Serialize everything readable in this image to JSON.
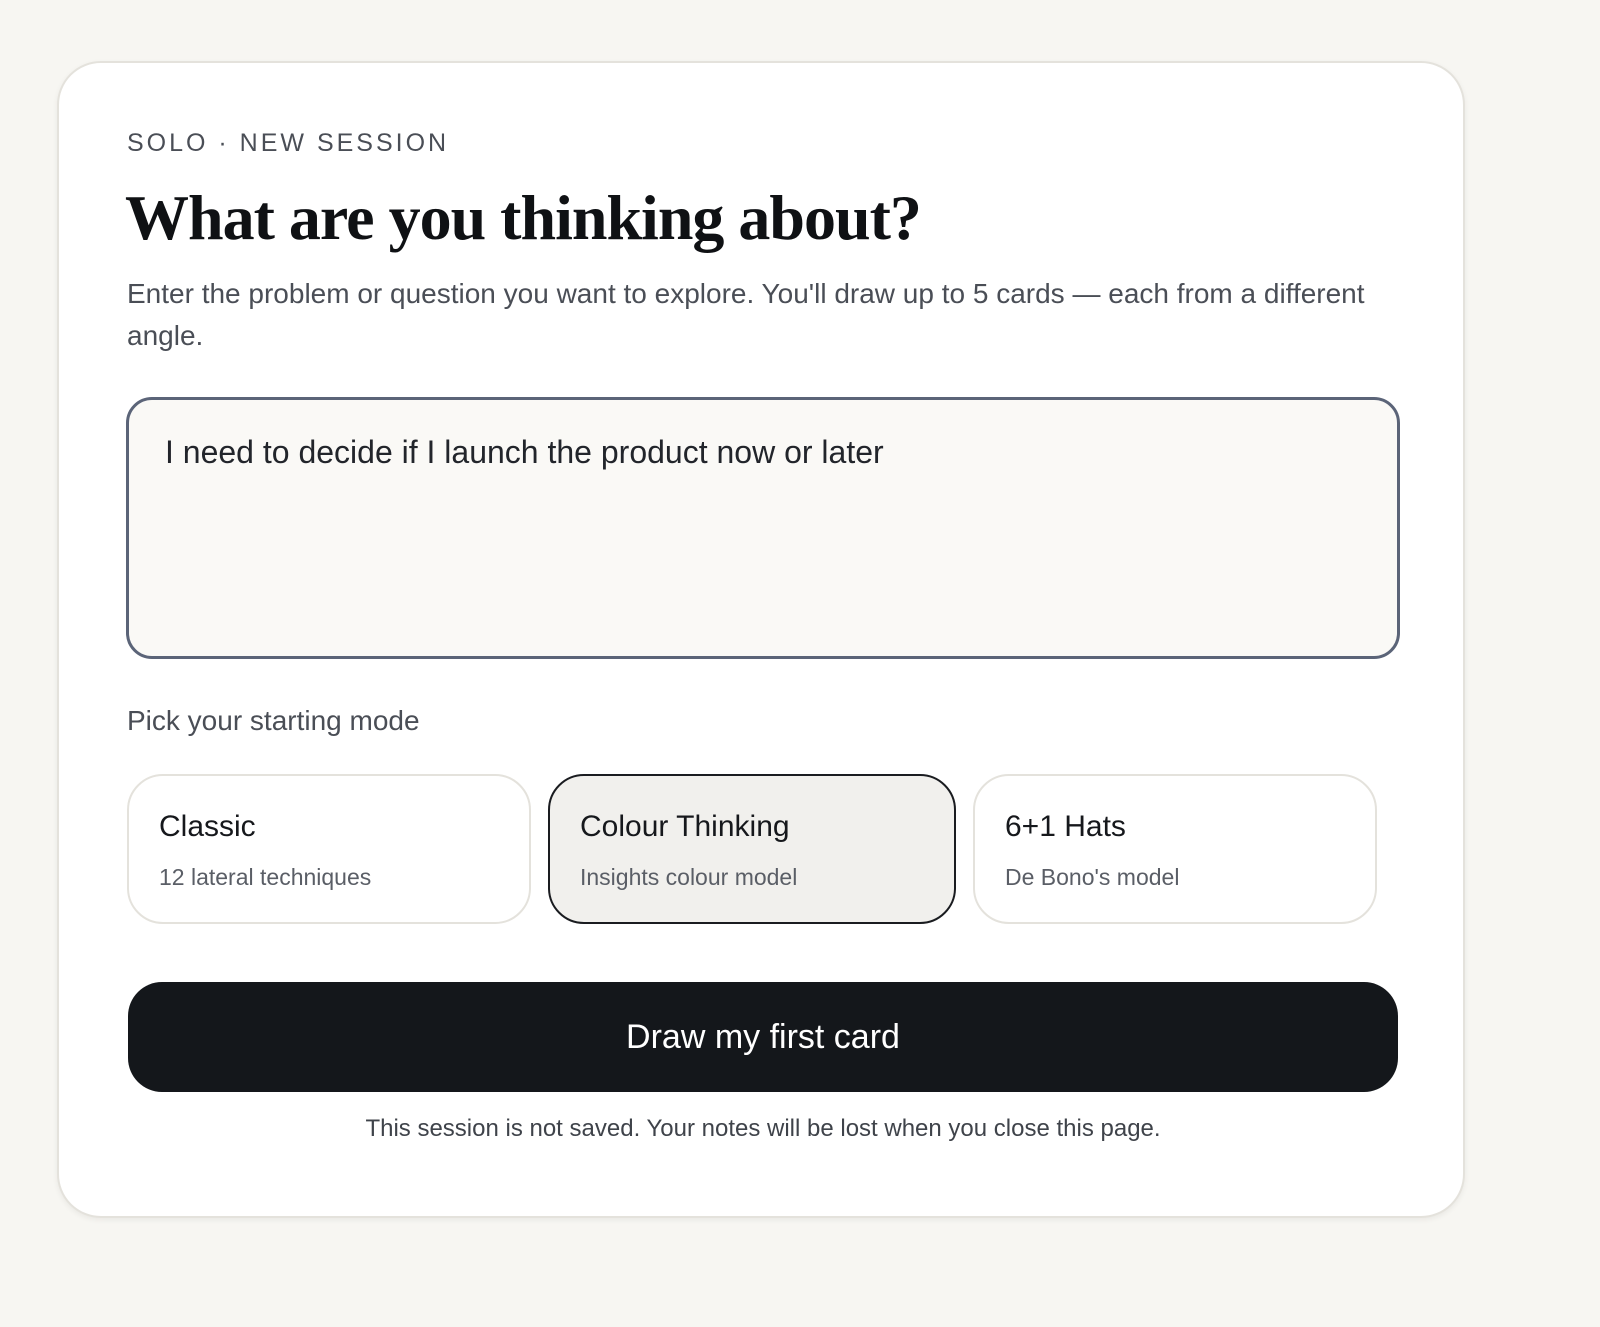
{
  "header": {
    "eyebrow": "SOLO · NEW SESSION",
    "title": "What are you thinking about?",
    "description": "Enter the problem or question you want to explore. You'll draw up to 5 cards — each from a different angle."
  },
  "prompt": {
    "value": "I need to decide if I launch the product now or later",
    "placeholder": ""
  },
  "modes": {
    "label": "Pick your starting mode",
    "selected": "Colour Thinking",
    "items": [
      {
        "name": "Classic",
        "subtitle": "12 lateral techniques"
      },
      {
        "name": "Colour Thinking",
        "subtitle": "Insights colour model"
      },
      {
        "name": "6+1 Hats",
        "subtitle": "De Bono's model"
      }
    ]
  },
  "actions": {
    "primary_label": "Draw my first card"
  },
  "footer": {
    "note": "This session is not saved. Your notes will be lost when you close this page."
  },
  "colors": {
    "background": "#f7f6f2",
    "card": "#ffffff",
    "button": "#14171b",
    "selected_mode_bg": "#f1f0ed",
    "input_border": "#5b6478"
  }
}
